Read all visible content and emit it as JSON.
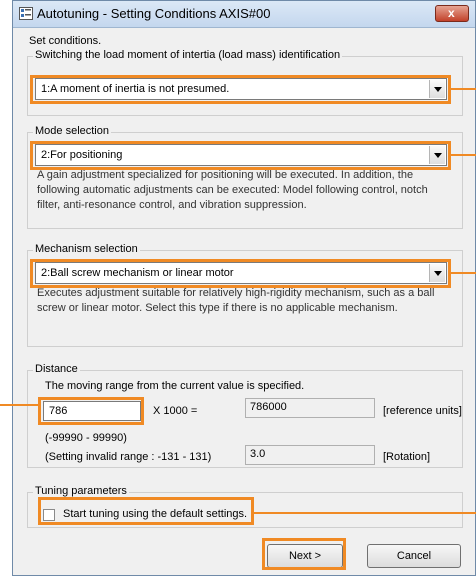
{
  "window": {
    "title": "Autotuning - Setting Conditions AXIS#00",
    "close_label": "x"
  },
  "intro": "Set conditions.",
  "inertia_group": {
    "legend": "Switching the load moment of intertia (load mass) identification",
    "selected": "1:A moment of inertia is not presumed."
  },
  "mode_group": {
    "legend": "Mode selection",
    "selected": "2:For positioning",
    "description": "A gain adjustment specialized for positioning will be executed. In addition, the following automatic adjustments can be executed: Model following control, notch filter, anti-resonance control, and vibration suppression."
  },
  "mechanism_group": {
    "legend": "Mechanism selection",
    "selected": "2:Ball screw mechanism or linear motor",
    "description": "Executes adjustment suitable for relatively high-rigidity mechanism, such as a ball screw or linear motor. Select this type if there is no applicable mechanism."
  },
  "distance_group": {
    "legend": "Distance",
    "note": "The moving range from the current value is specified.",
    "input_value": "786",
    "multiplier": "X 1000 =",
    "result_units": "786000",
    "units_label": "[reference units]",
    "range": "(-99990 - 99990)",
    "invalid_range": "(Setting invalid range : -131 - 131)",
    "result_rotation": "3.0",
    "rotation_label": "[Rotation]"
  },
  "tuning_group": {
    "legend": "Tuning parameters",
    "checkbox_label": "Start tuning using the default settings.",
    "checked": false
  },
  "buttons": {
    "next": "Next >",
    "cancel": "Cancel"
  },
  "colors": {
    "highlight": "#f08a24",
    "title_bar": "#c4d7ee",
    "close_button": "#c2412a"
  }
}
